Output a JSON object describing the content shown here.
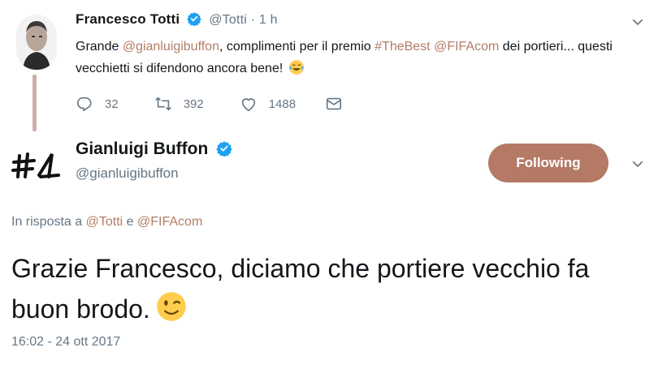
{
  "parent_tweet": {
    "display_name": "Francesco Totti",
    "handle": "@Totti",
    "separator": "·",
    "time": "1 h",
    "text_parts": [
      {
        "text": "Grande ",
        "accent": false
      },
      {
        "text": "@gianluigibuffon",
        "accent": true
      },
      {
        "text": ", complimenti per il premio ",
        "accent": false
      },
      {
        "text": "#TheBest",
        "accent": true
      },
      {
        "text": " ",
        "accent": false
      },
      {
        "text": "@FIFAcom",
        "accent": true
      },
      {
        "text": " dei portieri... questi vecchietti si difendono ancora bene!",
        "accent": false
      }
    ],
    "emoji": "face-with-tears-of-joy",
    "actions": {
      "reply_count": "32",
      "retweet_count": "392",
      "like_count": "1488"
    }
  },
  "main_tweet": {
    "display_name": "Gianluigi Buffon",
    "handle": "@gianluigibuffon",
    "follow_label": "Following",
    "reply_prefix": "In risposta a",
    "reply_user1": "@Totti",
    "reply_conj": "e",
    "reply_user2": "@FIFAcom",
    "text": "Grazie Francesco, diciamo che portiere vecchio fa buon brodo.",
    "emoji": "winking-face",
    "timestamp": "16:02 - 24 ott 2017"
  },
  "colors": {
    "accent": "#b47c66",
    "follow_button": "#b57a66",
    "muted": "#657786",
    "thread_line": "#cdb0a8",
    "verified": "#1da1f2"
  },
  "icons": [
    "reply-icon",
    "retweet-icon",
    "like-icon",
    "dm-icon",
    "chevron-down-icon",
    "verified-icon"
  ]
}
